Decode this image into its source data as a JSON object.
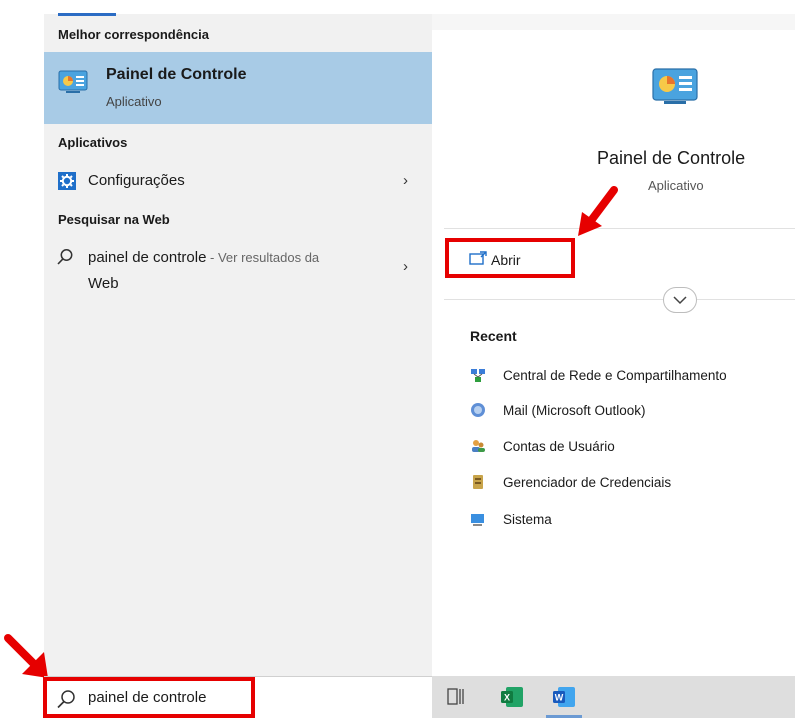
{
  "left": {
    "best_match_heading": "Melhor correspondência",
    "best_match": {
      "title": "Painel de Controle",
      "subtitle": "Aplicativo",
      "icon": "control-panel-icon"
    },
    "apps_heading": "Aplicativos",
    "apps": [
      {
        "label": "Configurações",
        "icon": "settings-gear-icon"
      }
    ],
    "web_heading": "Pesquisar na Web",
    "web_result": {
      "query": "painel de controle",
      "suffix_line1": " - Ver resultados da",
      "suffix_line2": "Web",
      "icon": "search-icon"
    }
  },
  "right": {
    "app_title": "Painel de Controle",
    "app_subtitle": "Aplicativo",
    "open_label": "Abrir",
    "recent_heading": "Recent",
    "recent_items": [
      {
        "label": "Central de Rede e Compartilhamento",
        "icon": "network-center-icon"
      },
      {
        "label": "Mail (Microsoft Outlook)",
        "icon": "mail-icon"
      },
      {
        "label": "Contas de Usuário",
        "icon": "user-accounts-icon"
      },
      {
        "label": "Gerenciador de Credenciais",
        "icon": "credential-manager-icon"
      },
      {
        "label": "Sistema",
        "icon": "system-icon"
      }
    ]
  },
  "search": {
    "value": "painel de controle"
  },
  "taskbar": {
    "apps": [
      "task-view-icon",
      "excel-icon",
      "word-icon"
    ],
    "excel_letter": "X",
    "word_letter": "W"
  },
  "colors": {
    "highlight_border": "#e60000",
    "selection": "#a8cbe6",
    "accent": "#2b6cc4"
  }
}
